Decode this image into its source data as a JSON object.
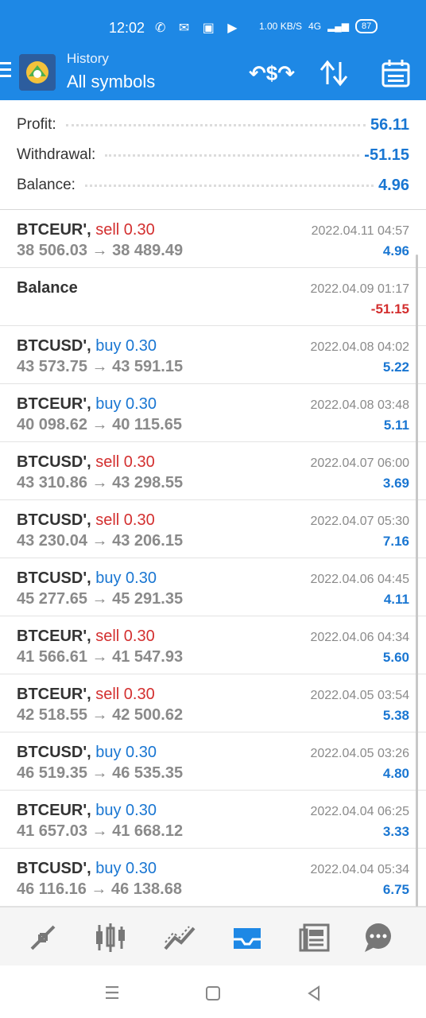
{
  "status_bar": {
    "time": "12:02",
    "left_icons": "✆ ✉ ▣ ▶",
    "speed": "1.00 KB/S",
    "network": "4G",
    "battery": "87"
  },
  "header": {
    "title": "History",
    "subtitle": "All symbols",
    "deposit_icon": "↶$↷"
  },
  "summary": [
    {
      "label": "Profit:",
      "value": "56.11"
    },
    {
      "label": "Withdrawal:",
      "value": "-51.15"
    },
    {
      "label": "Balance:",
      "value": "4.96"
    }
  ],
  "deals": [
    {
      "symbol": "BTCEUR',",
      "side": "sell",
      "volume": "0.30",
      "prices": "38 506.03 → 38 489.49",
      "time": "2022.04.11 04:57",
      "profit": "4.96"
    },
    {
      "symbol": "Balance",
      "side": "",
      "volume": "",
      "prices": "",
      "time": "2022.04.09 01:17",
      "profit": "-51.15"
    },
    {
      "symbol": "BTCUSD',",
      "side": "buy",
      "volume": "0.30",
      "prices": "43 573.75 → 43 591.15",
      "time": "2022.04.08 04:02",
      "profit": "5.22"
    },
    {
      "symbol": "BTCEUR',",
      "side": "buy",
      "volume": "0.30",
      "prices": "40 098.62 → 40 115.65",
      "time": "2022.04.08 03:48",
      "profit": "5.11"
    },
    {
      "symbol": "BTCUSD',",
      "side": "sell",
      "volume": "0.30",
      "prices": "43 310.86 → 43 298.55",
      "time": "2022.04.07 06:00",
      "profit": "3.69"
    },
    {
      "symbol": "BTCUSD',",
      "side": "sell",
      "volume": "0.30",
      "prices": "43 230.04 → 43 206.15",
      "time": "2022.04.07 05:30",
      "profit": "7.16"
    },
    {
      "symbol": "BTCUSD',",
      "side": "buy",
      "volume": "0.30",
      "prices": "45 277.65 → 45 291.35",
      "time": "2022.04.06 04:45",
      "profit": "4.11"
    },
    {
      "symbol": "BTCEUR',",
      "side": "sell",
      "volume": "0.30",
      "prices": "41 566.61 → 41 547.93",
      "time": "2022.04.06 04:34",
      "profit": "5.60"
    },
    {
      "symbol": "BTCEUR',",
      "side": "sell",
      "volume": "0.30",
      "prices": "42 518.55 → 42 500.62",
      "time": "2022.04.05 03:54",
      "profit": "5.38"
    },
    {
      "symbol": "BTCUSD',",
      "side": "buy",
      "volume": "0.30",
      "prices": "46 519.35 → 46 535.35",
      "time": "2022.04.05 03:26",
      "profit": "4.80"
    },
    {
      "symbol": "BTCEUR',",
      "side": "buy",
      "volume": "0.30",
      "prices": "41 657.03 → 41 668.12",
      "time": "2022.04.04 06:25",
      "profit": "3.33"
    },
    {
      "symbol": "BTCUSD',",
      "side": "buy",
      "volume": "0.30",
      "prices": "46 116.16 → 46 138.68",
      "time": "2022.04.04 05:34",
      "profit": "6.75"
    }
  ],
  "bottom_nav": [
    {
      "icon": "trade-arrows-icon",
      "active": false
    },
    {
      "icon": "candlestick-icon",
      "active": false
    },
    {
      "icon": "trend-chart-icon",
      "active": false
    },
    {
      "icon": "inbox-history-icon",
      "active": true
    },
    {
      "icon": "news-icon",
      "active": false
    },
    {
      "icon": "chat-icon",
      "active": false
    }
  ],
  "colors": {
    "header": "#1e88e5",
    "buy": "#1976d2",
    "sell": "#d32f2f",
    "profit_positive": "#1976d2",
    "profit_negative": "#d32f2f"
  }
}
